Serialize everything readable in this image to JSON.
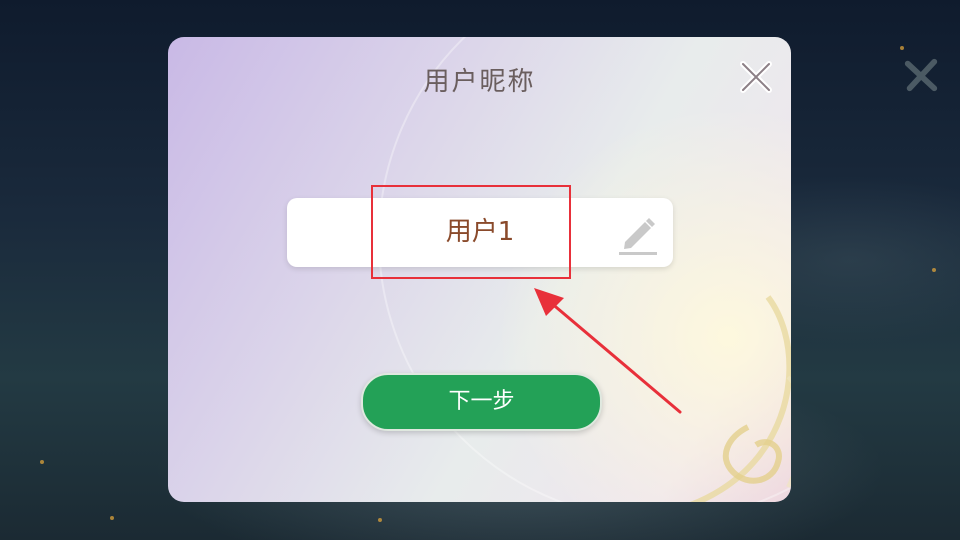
{
  "dialog": {
    "title": "用户昵称",
    "nickname_value": "用户1",
    "next_label": "下一步"
  },
  "icons": {
    "close": "close-x-icon",
    "edit": "pencil-icon",
    "background_close": "close-x-icon"
  },
  "colors": {
    "primary_button": "#23a157",
    "nickname_text": "#8a4a2b",
    "title_text": "#6a5e5e",
    "annotation": "#e8303a"
  }
}
